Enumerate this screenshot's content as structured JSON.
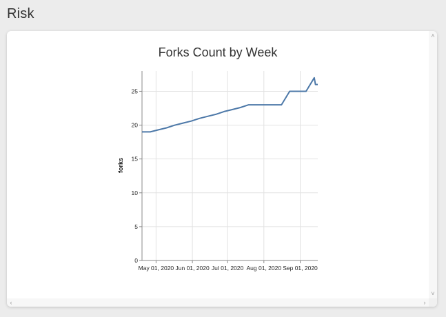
{
  "section": {
    "title": "Risk"
  },
  "chart_data": {
    "type": "line",
    "title": "Forks Count by Week",
    "xlabel": "",
    "ylabel": "forks",
    "x_tick_labels": [
      "May 01, 2020",
      "Jun 01, 2020",
      "Jul 01, 2020",
      "Aug 01, 2020",
      "Sep 01, 2020"
    ],
    "x_ticks": [
      "2020-05-01",
      "2020-06-01",
      "2020-07-01",
      "2020-08-01",
      "2020-09-01"
    ],
    "xlim": [
      "2020-04-19",
      "2020-09-16"
    ],
    "y_ticks": [
      0,
      5,
      10,
      15,
      20,
      25
    ],
    "ylim": [
      0,
      28
    ],
    "grid": true,
    "series": [
      {
        "color": "#4c78a8",
        "points": [
          {
            "x": "2020-04-19",
            "y": 19
          },
          {
            "x": "2020-04-26",
            "y": 19
          },
          {
            "x": "2020-05-03",
            "y": 19.3
          },
          {
            "x": "2020-05-10",
            "y": 19.6
          },
          {
            "x": "2020-05-17",
            "y": 20
          },
          {
            "x": "2020-05-24",
            "y": 20.3
          },
          {
            "x": "2020-05-31",
            "y": 20.6
          },
          {
            "x": "2020-06-07",
            "y": 21
          },
          {
            "x": "2020-06-14",
            "y": 21.3
          },
          {
            "x": "2020-06-21",
            "y": 21.6
          },
          {
            "x": "2020-06-28",
            "y": 22
          },
          {
            "x": "2020-07-05",
            "y": 22.3
          },
          {
            "x": "2020-07-12",
            "y": 22.6
          },
          {
            "x": "2020-07-19",
            "y": 23
          },
          {
            "x": "2020-07-26",
            "y": 23
          },
          {
            "x": "2020-08-02",
            "y": 23
          },
          {
            "x": "2020-08-09",
            "y": 23
          },
          {
            "x": "2020-08-16",
            "y": 23
          },
          {
            "x": "2020-08-23",
            "y": 25
          },
          {
            "x": "2020-08-30",
            "y": 25
          },
          {
            "x": "2020-09-06",
            "y": 25
          },
          {
            "x": "2020-09-13",
            "y": 27
          },
          {
            "x": "2020-09-14",
            "y": 26
          },
          {
            "x": "2020-09-16",
            "y": 26
          }
        ]
      }
    ]
  },
  "scroll": {
    "up_icon": "˄",
    "down_icon": "˅",
    "left_icon": "‹",
    "right_icon": "›"
  }
}
